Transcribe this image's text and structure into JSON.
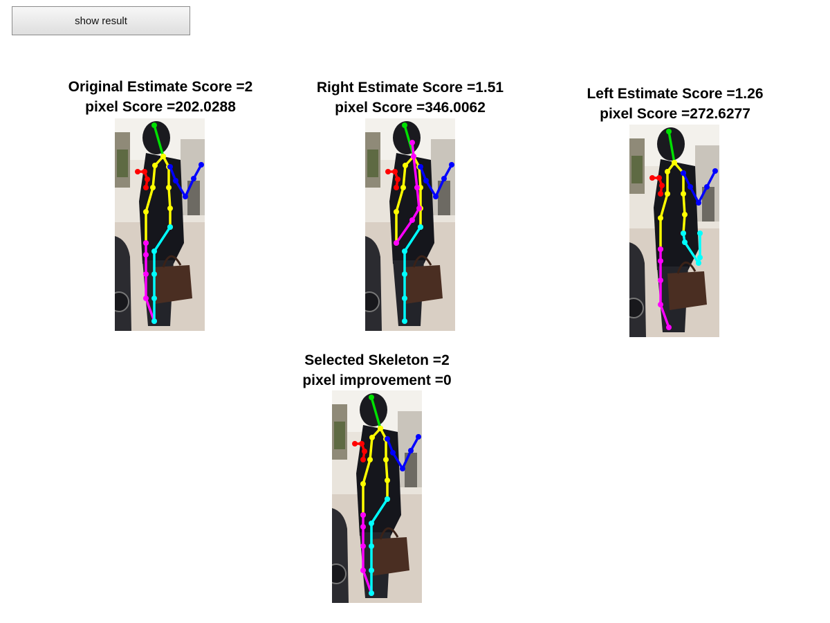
{
  "controls": {
    "show_result_label": "show result"
  },
  "panels": [
    {
      "id": "original",
      "title_line1": "Original Estimate Score =2",
      "title_line2": "pixel Score =202.0288",
      "skeleton": "original"
    },
    {
      "id": "right",
      "title_line1": "Right Estimate Score =1.51",
      "title_line2": "pixel Score =346.0062",
      "skeleton": "right"
    },
    {
      "id": "left",
      "title_line1": "Left Estimate Score =1.26",
      "title_line2": "pixel Score =272.6277",
      "skeleton": "left"
    },
    {
      "id": "selected",
      "title_line1": "Selected Skeleton =2",
      "title_line2": "pixel improvement =0",
      "skeleton": "original"
    }
  ],
  "limb_colors": {
    "head": "#00e000",
    "torso": "#ffff00",
    "left_arm": "#ff0000",
    "right_arm": "#0000ff",
    "left_leg": "#ff00ff",
    "right_leg": "#00ffff"
  }
}
